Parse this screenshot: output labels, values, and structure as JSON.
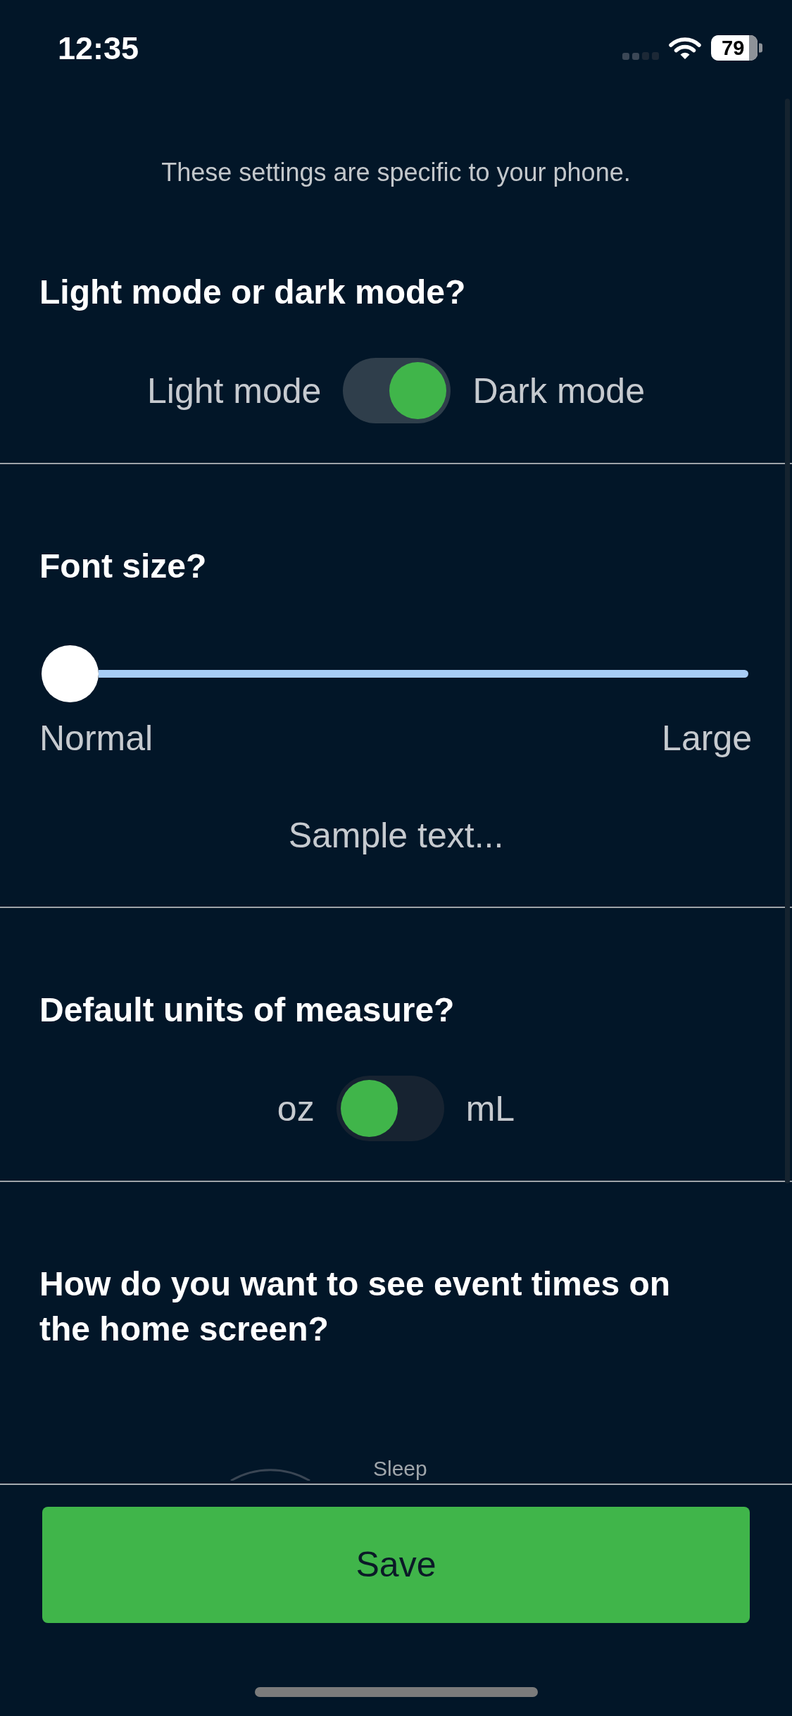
{
  "status_bar": {
    "time": "12:35",
    "battery": "79"
  },
  "intro": "These settings are specific to your phone.",
  "sections": [
    {
      "kind": "toggle",
      "question": "Light mode or dark mode?",
      "off_label": "Light mode",
      "on_label": "Dark mode",
      "on": true
    },
    {
      "kind": "slider",
      "question": "Font size?",
      "level": 0,
      "min_label": "Normal",
      "max_label": "Large",
      "sample": "Sample text..."
    },
    {
      "kind": "toggle",
      "question": "Default units of measure?",
      "off_label": "oz",
      "on_label": "mL",
      "on": false
    },
    {
      "kind": "options",
      "question": "How do you want to see event times on the home screen?",
      "option_label": "Sleep"
    }
  ],
  "save_button": "Save"
}
